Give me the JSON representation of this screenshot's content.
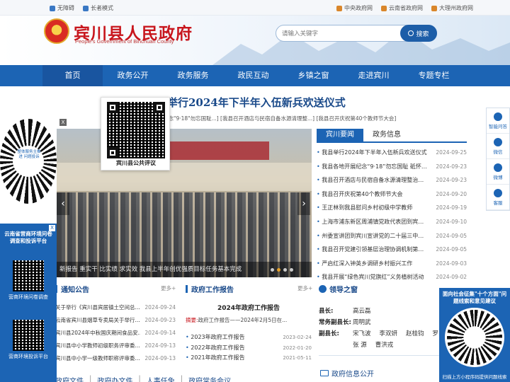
{
  "topbar": {
    "left": [
      {
        "label": "无障碍",
        "icon": "accessibility-icon"
      },
      {
        "label": "长者模式",
        "icon": "elder-mode-icon"
      }
    ],
    "right": [
      {
        "label": "中央政府网",
        "icon": "home-icon"
      },
      {
        "label": "云南省政府网",
        "icon": "home-icon"
      },
      {
        "label": "大理州政府网",
        "icon": "home-icon"
      }
    ]
  },
  "header": {
    "title": "宾川县人民政府",
    "subtitle": "People's Government of Binchuan County",
    "search_placeholder": "请输入关键字",
    "search_button": "搜索"
  },
  "nav": {
    "items": [
      "首页",
      "政务公开",
      "政务服务",
      "政民互动",
      "乡镇之窗",
      "走进宾川",
      "专题专栏"
    ],
    "active_index": 0
  },
  "headline": {
    "title": "我县举行2024年下半年入伍新兵欢送仪式",
    "links": "纪念\"9·18\"勿忘国耻...] [我县召开酒店与民宿自备水源清理整...] [我县召开庆祝第40个教师节大会]"
  },
  "slider": {
    "caption": "新报告 重实干 比实绩 求实效 我县上半年创优强质目标任务基本完成",
    "dots": 4,
    "active_dot": 1
  },
  "news": {
    "tabs": [
      "宾川要闻",
      "政务信息"
    ],
    "active_tab": 0,
    "items": [
      {
        "title": "我县举行2024年下半年入伍新兵欢送仪式",
        "date": "2024-09-25"
      },
      {
        "title": "我县各地开展纪念“9·18”勿忘国耻 砥怀革...",
        "date": "2024-09-23"
      },
      {
        "title": "我县召开酒店与民宿自备水源清理整治工...",
        "date": "2024-09-23"
      },
      {
        "title": "我县召开庆祝第40个教师节大会",
        "date": "2024-09-20"
      },
      {
        "title": "王正林到我县慰问乡村初级中学教师",
        "date": "2024-09-19"
      },
      {
        "title": "上海市浦东新区周浦镇党政代表团到宾川...",
        "date": "2024-09-10"
      },
      {
        "title": "州委宣讲团到宾川宣讲党的二十届三中全...",
        "date": "2024-09-05"
      },
      {
        "title": "我县召开党建引领基层治理协调机制第一...",
        "date": "2024-09-05"
      },
      {
        "title": "严启红深入钟英乡调研乡村振兴工作",
        "date": "2024-09-03"
      },
      {
        "title": "我县开展“绿色宾川党旗红”义务植树活动",
        "date": "2024-09-02"
      }
    ]
  },
  "notice": {
    "title": "通知公告",
    "more": "更多+",
    "items": [
      {
        "title": "关于举行《宾川县宾居镇土空间总...",
        "date": "2024-09-24"
      },
      {
        "title": "云南省宾川县烟草专卖局关于举行...",
        "date": "2024-09-23"
      },
      {
        "title": "宾川县2024年中秋国庆期间食品安...",
        "date": "2024-09-14"
      },
      {
        "title": "宾川县中小学教师初级职务评审委...",
        "date": "2024-09-13"
      },
      {
        "title": "宾川县中小学一级教师职称评审委...",
        "date": "2024-09-13"
      }
    ]
  },
  "report": {
    "title": "政府工作报告",
    "more": "更多+",
    "headline": "2024年政府工作报告",
    "abstract_label": "摘要:",
    "abstract": "政府工作报告——2024年2月5日在...",
    "items": [
      {
        "title": "2023年政府工作报告",
        "date": "2023-02-24"
      },
      {
        "title": "2022年政府工作报告",
        "date": "2022-01-20"
      },
      {
        "title": "2021年政府工作报告",
        "date": "2021-05-11"
      }
    ]
  },
  "leaders": {
    "title": "领导之窗",
    "rows": [
      {
        "role": "县长:",
        "names": [
          "高云磊"
        ]
      },
      {
        "role": "常务副县长:",
        "names": [
          "周明武"
        ]
      },
      {
        "role": "副县长:",
        "names": [
          "宋飞波",
          "李双妍",
          "赵桂钧",
          "罗"
        ]
      },
      {
        "role": "",
        "names": [
          "张 源",
          "曹洪戎"
        ]
      }
    ]
  },
  "open_info": "政府信息公开",
  "bottom_tabs": [
    "政府文件",
    "政府办文件",
    "人事任免",
    "政府常务会议"
  ],
  "qr_popup": {
    "caption": "宾川县公共评议"
  },
  "left_mini": {
    "center": "整体服务主推进\n问题投诉",
    "close": "X"
  },
  "left_float": {
    "close": "X",
    "title": "云南省营商环境问卷调查和投诉平台",
    "label1": "营商环境问卷调查",
    "label2": "营商环境投诉平台"
  },
  "right_toolbar": [
    {
      "label": "智能问答",
      "icon": "chat-icon"
    },
    {
      "label": "微信",
      "icon": "wechat-icon"
    },
    {
      "label": "微博",
      "icon": "weibo-icon"
    },
    {
      "label": "客服",
      "icon": "service-icon"
    }
  ],
  "right_float": {
    "title": "面向社会征集\"十个方面\"问题线索和意见建议",
    "foot": "扫描上方小程序码提供问题线索"
  },
  "colors": {
    "primary": "#1c64b4",
    "title_red": "#c8161d"
  }
}
